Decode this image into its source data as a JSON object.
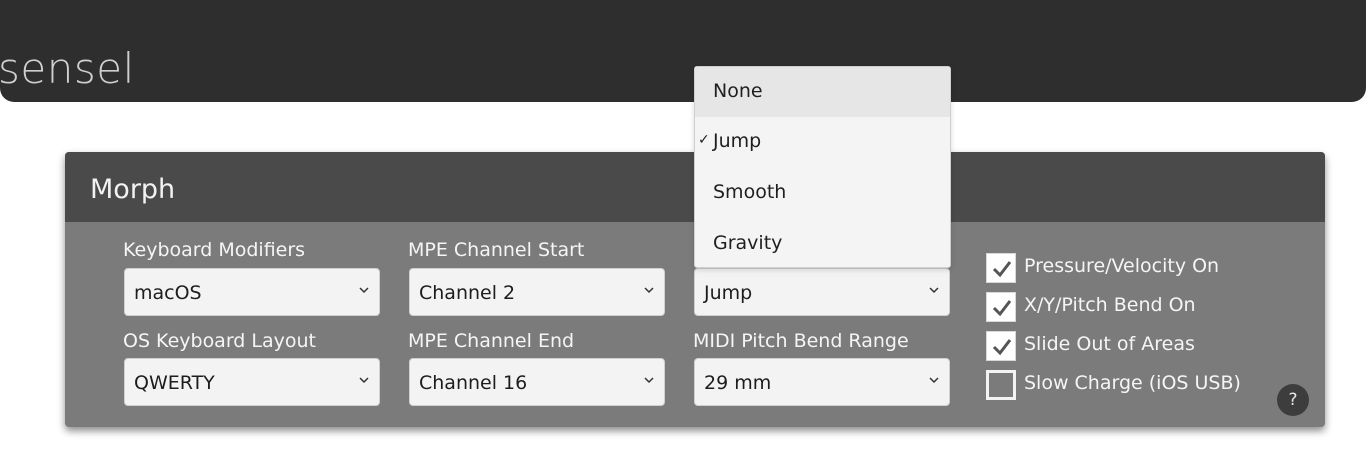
{
  "header": {
    "logo_text": "sensel"
  },
  "panel": {
    "title": "Morph",
    "fields": {
      "keyboard_modifiers": {
        "label": "Keyboard Modifiers",
        "value": "macOS"
      },
      "mpe_channel_start": {
        "label": "MPE Channel Start",
        "value": "Channel 2"
      },
      "third_select": {
        "value": "Jump"
      },
      "os_keyboard_layout": {
        "label": "OS Keyboard Layout",
        "value": "QWERTY"
      },
      "mpe_channel_end": {
        "label": "MPE Channel End",
        "value": "Channel 16"
      },
      "midi_pitch_bend_range": {
        "label": "MIDI Pitch Bend Range",
        "value": "29 mm"
      }
    },
    "checkboxes": [
      {
        "label": "Pressure/Velocity On",
        "checked": true
      },
      {
        "label": "X/Y/Pitch Bend On",
        "checked": true
      },
      {
        "label": "Slide Out of Areas",
        "checked": true
      },
      {
        "label": "Slow Charge (iOS USB)",
        "checked": false
      }
    ],
    "help_label": "?"
  },
  "dropdown": {
    "options": [
      {
        "label": "None",
        "selected": false,
        "highlighted": true
      },
      {
        "label": "Jump",
        "selected": true,
        "highlighted": false
      },
      {
        "label": "Smooth",
        "selected": false,
        "highlighted": false
      },
      {
        "label": "Gravity",
        "selected": false,
        "highlighted": false
      }
    ],
    "check_mark": "✓"
  },
  "colors": {
    "topbar": "#2e2e2e",
    "panel_header": "#4a4a4a",
    "panel_body": "#7b7b7b"
  }
}
